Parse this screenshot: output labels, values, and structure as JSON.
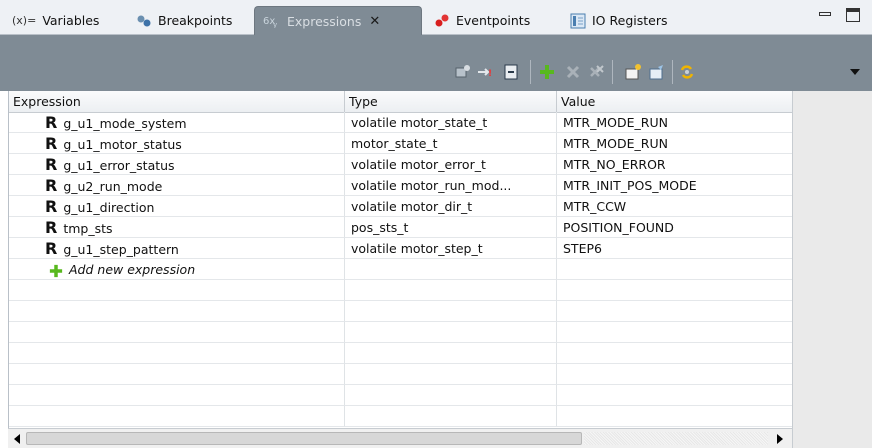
{
  "tabs": [
    {
      "prefix": "(x)=",
      "label": "Variables",
      "icon": "variables-icon",
      "active": false
    },
    {
      "label": "Breakpoints",
      "icon": "breakpoints-icon",
      "active": false
    },
    {
      "label": "Expressions",
      "icon": "expressions-icon",
      "active": true,
      "close": "✕"
    },
    {
      "label": "Eventpoints",
      "icon": "eventpoints-icon",
      "active": false
    },
    {
      "label": "IO Registers",
      "icon": "io-registers-icon",
      "active": false
    }
  ],
  "columns": {
    "expression": "Expression",
    "type": "Type",
    "value": "Value"
  },
  "rows": [
    {
      "marker": "R",
      "expression": "g_u1_mode_system",
      "type": "volatile motor_state_t",
      "value": "MTR_MODE_RUN"
    },
    {
      "marker": "R",
      "expression": "g_u1_motor_status",
      "type": "motor_state_t",
      "value": "MTR_MODE_RUN"
    },
    {
      "marker": "R",
      "expression": "g_u1_error_status",
      "type": "volatile motor_error_t",
      "value": "MTR_NO_ERROR"
    },
    {
      "marker": "R",
      "expression": "g_u2_run_mode",
      "type": "volatile motor_run_mod...",
      "value": "MTR_INIT_POS_MODE"
    },
    {
      "marker": "R",
      "expression": "g_u1_direction",
      "type": "volatile motor_dir_t",
      "value": "MTR_CCW"
    },
    {
      "marker": "R",
      "expression": "tmp_sts",
      "type": "pos_sts_t",
      "value": "POSITION_FOUND"
    },
    {
      "marker": "R",
      "expression": "g_u1_step_pattern",
      "type": "volatile motor_step_t",
      "value": "STEP6"
    }
  ],
  "add_expression": "Add new expression",
  "colors": {
    "toolbar": "#7f8b95",
    "add_green": "#58b81e",
    "delete_gray": "#a9b1b8",
    "eventpoint_red": "#d81e1e"
  }
}
